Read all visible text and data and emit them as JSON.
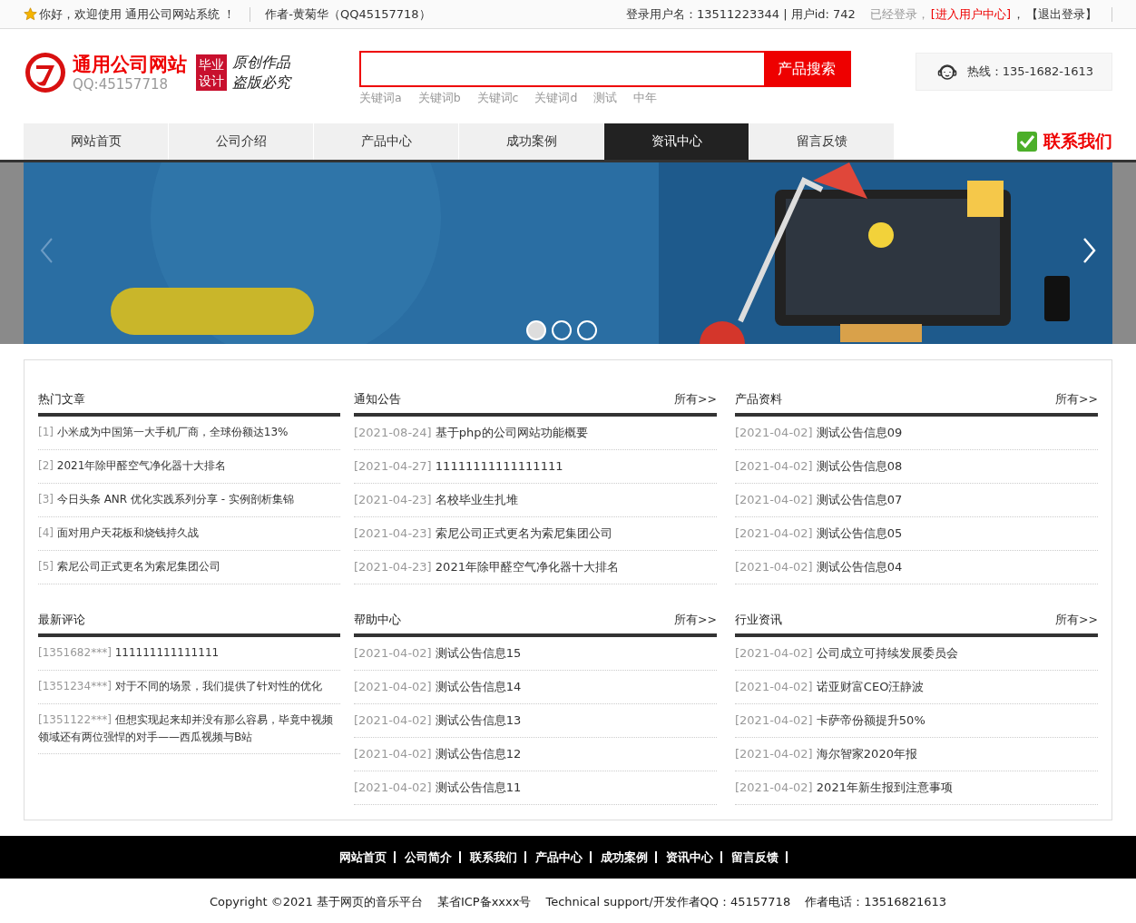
{
  "topbar": {
    "greeting": "你好，欢迎使用 通用公司网站系统 ！",
    "author": "作者-黄菊华（QQ45157718）",
    "user_info": "登录用户名：13511223344 | 用户id: 742",
    "login_status": "已经登录，",
    "user_center": "[进入用户中心]",
    "separator": "，",
    "logout": "【退出登录】"
  },
  "header": {
    "logo": {
      "name": "通用公司网站",
      "qq": "QQ:45157718",
      "badge_lines": [
        "毕业",
        "设计"
      ],
      "slogan_lines": [
        "原创作品",
        "盗版必究"
      ]
    },
    "search": {
      "button": "产品搜索",
      "keywords": [
        "关键词a",
        "关键词b",
        "关键词c",
        "关键词d",
        "测试",
        "中年"
      ]
    },
    "hotline": "热线：135-1682-1613"
  },
  "nav": {
    "items": [
      {
        "label": "网站首页",
        "selected": false
      },
      {
        "label": "公司介绍",
        "selected": false
      },
      {
        "label": "产品中心",
        "selected": false
      },
      {
        "label": "成功案例",
        "selected": false
      },
      {
        "label": "资讯中心",
        "selected": true
      },
      {
        "label": "留言反馈",
        "selected": false
      }
    ],
    "contact": "联系我们"
  },
  "banner": {
    "kind": "picture",
    "dots": [
      {
        "selected": true
      },
      {
        "selected": false
      },
      {
        "selected": false
      }
    ]
  },
  "columns": [
    [
      {
        "title": "热门文章",
        "items": [
          {
            "tag": "[1]",
            "text": "小米成为中国第一大手机厂商，全球份额达13%"
          },
          {
            "tag": "[2]",
            "text": "2021年除甲醛空气净化器十大排名"
          },
          {
            "tag": "[3]",
            "text": "今日头条 ANR 优化实践系列分享 - 实例剖析集锦"
          },
          {
            "tag": "[4]",
            "text": "面对用户天花板和烧钱持久战"
          },
          {
            "tag": "[5]",
            "text": "索尼公司正式更名为索尼集团公司"
          }
        ]
      },
      {
        "title": "最新评论",
        "items": [
          {
            "tag": "[1351682***]",
            "text": "111111111111111"
          },
          {
            "tag": "[1351234***]",
            "text": "对于不同的场景，我们提供了针对性的优化"
          },
          {
            "tag": "[1351122***]",
            "text": "但想实现起来却并没有那么容易，毕竟中视频领域还有两位强悍的对手——西瓜视频与B站"
          }
        ]
      }
    ],
    [
      {
        "title": "通知公告",
        "more": "所有>>",
        "items": [
          {
            "tag": "[2021-08-24]",
            "text": "基于php的公司网站功能概要"
          },
          {
            "tag": "[2021-04-27]",
            "text": "11111111111111111"
          },
          {
            "tag": "[2021-04-23]",
            "text": "名校毕业生扎堆"
          },
          {
            "tag": "[2021-04-23]",
            "text": "索尼公司正式更名为索尼集团公司"
          },
          {
            "tag": "[2021-04-23]",
            "text": "2021年除甲醛空气净化器十大排名"
          }
        ]
      },
      {
        "title": "帮助中心",
        "more": "所有>>",
        "items": [
          {
            "tag": "[2021-04-02]",
            "text": "测试公告信息15"
          },
          {
            "tag": "[2021-04-02]",
            "text": "测试公告信息14"
          },
          {
            "tag": "[2021-04-02]",
            "text": "测试公告信息13"
          },
          {
            "tag": "[2021-04-02]",
            "text": "测试公告信息12"
          },
          {
            "tag": "[2021-04-02]",
            "text": "测试公告信息11"
          }
        ]
      }
    ],
    [
      {
        "title": "产品资料",
        "more": "所有>>",
        "items": [
          {
            "tag": "[2021-04-02]",
            "text": "测试公告信息09"
          },
          {
            "tag": "[2021-04-02]",
            "text": "测试公告信息08"
          },
          {
            "tag": "[2021-04-02]",
            "text": "测试公告信息07"
          },
          {
            "tag": "[2021-04-02]",
            "text": "测试公告信息05"
          },
          {
            "tag": "[2021-04-02]",
            "text": "测试公告信息04"
          }
        ]
      },
      {
        "title": "行业资讯",
        "more": "所有>>",
        "items": [
          {
            "tag": "[2021-04-02]",
            "text": "公司成立可持续发展委员会"
          },
          {
            "tag": "[2021-04-02]",
            "text": "诺亚财富CEO汪静波"
          },
          {
            "tag": "[2021-04-02]",
            "text": "卡萨帝份额提升50%"
          },
          {
            "tag": "[2021-04-02]",
            "text": "海尔智家2020年报"
          },
          {
            "tag": "[2021-04-02]",
            "text": "2021年新生报到注意事项"
          }
        ]
      }
    ]
  ],
  "footer": {
    "links": [
      "网站首页",
      "公司简介",
      "联系我们",
      "产品中心",
      "成功案例",
      "资讯中心",
      "留言反馈"
    ],
    "copyright": [
      "Copyright ©2021 基于网页的音乐平台",
      "某省ICP备xxxx号",
      "Technical support/开发作者QQ：45157718",
      "作者电话：13516821613"
    ]
  }
}
